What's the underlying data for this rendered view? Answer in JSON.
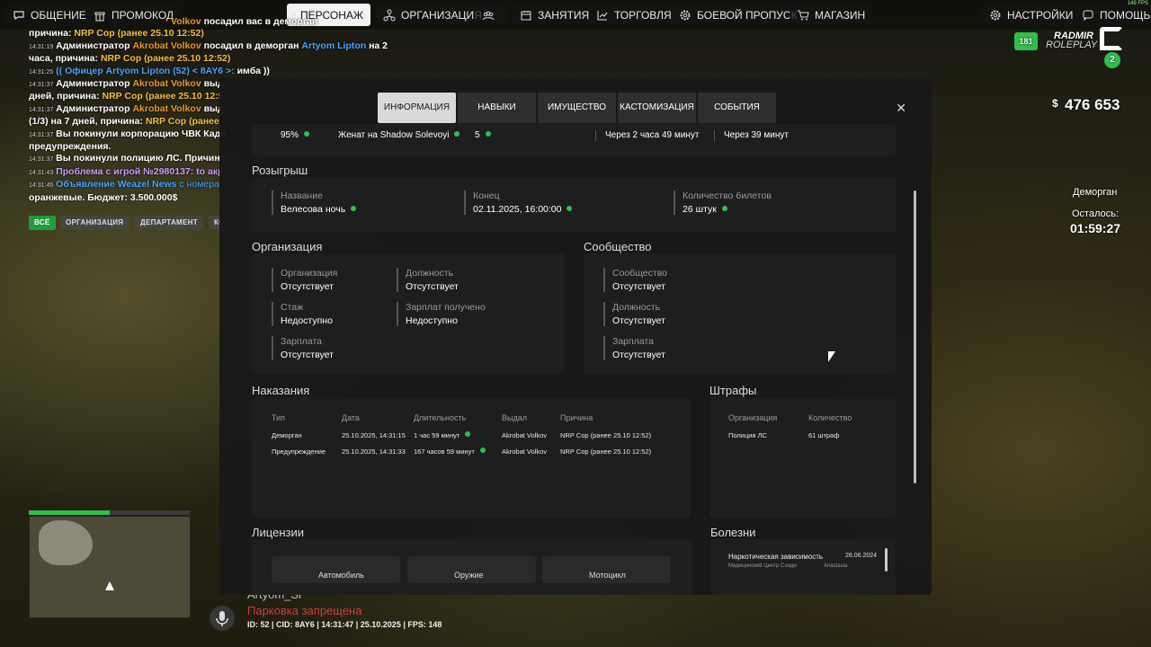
{
  "topnav": [
    {
      "key": "chat",
      "label": "ОБЩЕНИЕ"
    },
    {
      "key": "promo",
      "label": "ПРОМОКОД"
    },
    {
      "key": "character",
      "label": "ПЕРСОНАЖ",
      "active": true
    },
    {
      "key": "org",
      "label": "ОРГАНИЗАЦИЯ"
    },
    {
      "key": "group",
      "label": ""
    },
    {
      "key": "lessons",
      "label": "ЗАНЯТИЯ"
    },
    {
      "key": "trade",
      "label": "ТОРГОВЛЯ"
    },
    {
      "key": "battlepass",
      "label": "БОЕВОЙ ПРОПУСК"
    },
    {
      "key": "shop",
      "label": "МАГАЗИН"
    },
    {
      "key": "settings",
      "label": "НАСТРОЙКИ"
    },
    {
      "key": "help",
      "label": "ПОМОЩЬ"
    }
  ],
  "fps_corner": "149 FPS",
  "chat": {
    "lines": [
      {
        "pre": "",
        "name": "Volkov",
        "text": " посадил вас в деморган"
      },
      {
        "pre": "причина: ",
        "name": "NRP Cop (ранее 25.10 12:52)",
        "text": ""
      },
      {
        "ts": "14:31:19",
        "text": "Администратор ",
        "name": "Akrobat Volkov",
        "text2": " посадил в деморган ",
        "name2": "Artyom Lipton",
        "text3": " на 2"
      },
      {
        "text": "часа, причина: ",
        "name": "NRP Cop (ранее 25.10 12:52)"
      },
      {
        "ts": "14:31:25",
        "text": "(( ",
        "name": "Офицер Artyom Lipton (52) < 8AY6 >:",
        "text2": " имба ))"
      },
      {
        "ts": "14:31:37",
        "text": "Администратор ",
        "name": "Akrobat Volkov",
        "text2": " выд"
      },
      {
        "text": "дней, причина: ",
        "name": "NRP Cop (ранее 25.10 12:5"
      },
      {
        "ts": "14:31:37",
        "text": "Администратор ",
        "name": "Akrobat Volkov",
        "text2": " выд"
      },
      {
        "text": "(1/3) на 7 дней, причина: ",
        "name": "NRP Cop (ранее"
      },
      {
        "ts": "14:31:37",
        "text": "Вы покинули корпорацию ЧВК Кади"
      },
      {
        "text": "предупреждения."
      },
      {
        "ts": "14:31:37",
        "text": "Вы покинули полицию ЛС. Причина"
      },
      {
        "ts": "14:31:43",
        "name": "Проблема с игрой №2980137: to акр"
      },
      {
        "ts": "14:31:45",
        "name": "Объявление Weazel News",
        "text2": " с номера"
      },
      {
        "text": "оранжевые. Бюджет: 3.500.000$"
      }
    ],
    "filters": [
      "ВСЁ",
      "ОРГАНИЗАЦИЯ",
      "ДЕПАРТАМЕНТ",
      "КО"
    ]
  },
  "modal": {
    "tabs": [
      "ИНФОРМАЦИЯ",
      "НАВЫКИ",
      "ИМУЩЕСТВО",
      "КАСТОМИЗАЦИЯ",
      "СОБЫТИЯ"
    ],
    "top_row": [
      "95%",
      "Женат на Shadow Solevoyi",
      "5",
      "Через 2 часа 49 минут",
      "Через 39 минут"
    ],
    "raffle": {
      "title": "Розыгрыш",
      "fields": [
        {
          "label": "Название",
          "value": "Велесова ночь"
        },
        {
          "label": "Конец",
          "value": "02.11.2025, 16:00:00"
        },
        {
          "label": "Количество билетов",
          "value": "26 штук"
        }
      ]
    },
    "organization": {
      "title": "Организация",
      "fields": [
        {
          "label": "Организация",
          "value": "Отсутствует"
        },
        {
          "label": "Должность",
          "value": "Отсутствует"
        },
        {
          "label": "Стаж",
          "value": "Недоступно"
        },
        {
          "label": "Зарплат получено",
          "value": "Недоступно"
        },
        {
          "label": "Зарплата",
          "value": "Отсутствует"
        }
      ]
    },
    "community": {
      "title": "Сообщество",
      "fields": [
        {
          "label": "Сообщество",
          "value": "Отсутствует"
        },
        {
          "label": "Должность",
          "value": "Отсутствует"
        },
        {
          "label": "Зарплата",
          "value": "Отсутствует"
        }
      ]
    },
    "punishments": {
      "title": "Наказания",
      "columns": [
        "Тип",
        "Дата",
        "Длительность",
        "Выдал",
        "Причина"
      ],
      "rows": [
        [
          "Деморган",
          "25.10.2025, 14:31:15",
          "1 час 59 минут",
          "Akrobat Volkov",
          "NRP Cop (ранее 25.10 12:52)"
        ],
        [
          "Предупреждение",
          "25.10.2025, 14:31:33",
          "167 часов 59 минут",
          "Akrobat Volkov",
          "NRP Cop (ранее 25.10 12:52)"
        ]
      ]
    },
    "fines": {
      "title": "Штрафы",
      "columns": [
        "Организация",
        "Количество"
      ],
      "rows": [
        [
          "Полиция ЛС",
          "61 штраф"
        ]
      ]
    },
    "licenses": {
      "title": "Лицензии",
      "items": [
        "Автомобиль",
        "Оружие",
        "Мотоцикл"
      ]
    },
    "diseases": {
      "title": "Болезни",
      "items": [
        {
          "name": "Наркотическая зависимость",
          "date": "28.06.2024",
          "place": "Медицинский Центр Сэнди-",
          "doctor": "Anastasia"
        }
      ]
    }
  },
  "hud": {
    "logo_top": "RADMIR",
    "logo_bottom": "ROLEPLAY",
    "server_badge": "181",
    "server_num": "2",
    "money_symbol": "$",
    "money": "476 653",
    "jail_label": "Деморган",
    "remaining_label": "Осталось:",
    "remaining": "01:59:27",
    "health": "100",
    "armor": "0",
    "player_name": "Artyom_Si",
    "zone_text": "Парковка запрещена",
    "status_line": "ID: 52 | CID: 8AY6 | 14:31:47   | 25.10.2025 | FPS: 148",
    "accent": "#2fbf4a"
  }
}
